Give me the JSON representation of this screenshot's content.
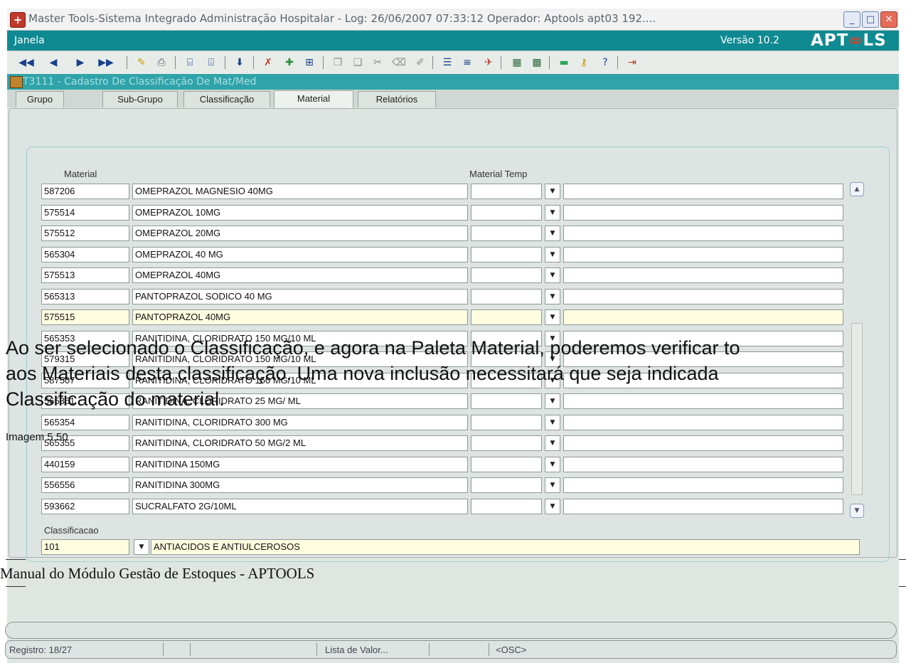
{
  "window": {
    "title": "Master Tools-Sistema Integrado Administração Hospitalar - Log: 26/06/2007 07:33:12 Operador: Aptools apt03 192....",
    "controls": {
      "minimize": "_",
      "maximize": "□",
      "close": "✕"
    }
  },
  "menubar": {
    "janela": "Janela",
    "version": "Versão 10.2",
    "logo_a": "APT",
    "logo_o": "∞",
    "logo_b": "LS"
  },
  "form": {
    "title": "T3111 - Cadastro De Classificação De Mat/Med"
  },
  "tabs": [
    {
      "label": "Grupo",
      "active": false
    },
    {
      "label": "Sub-Grupo",
      "active": false
    },
    {
      "label": "Classificação",
      "active": false
    },
    {
      "label": "Material",
      "active": true
    },
    {
      "label": "Relatórios",
      "active": false
    }
  ],
  "grid": {
    "header_material": "Material",
    "header_material_temp": "Material Temp",
    "rows": [
      {
        "code": "587206",
        "name": "OMEPRAZOL MAGNESIO 40MG",
        "temp": "",
        "desc": ""
      },
      {
        "code": "575514",
        "name": "OMEPRAZOL 10MG",
        "temp": "",
        "desc": ""
      },
      {
        "code": "575512",
        "name": "OMEPRAZOL 20MG",
        "temp": "",
        "desc": ""
      },
      {
        "code": "565304",
        "name": "OMEPRAZOL 40 MG",
        "temp": "",
        "desc": ""
      },
      {
        "code": "575513",
        "name": "OMEPRAZOL 40MG",
        "temp": "",
        "desc": ""
      },
      {
        "code": "565313",
        "name": "PANTOPRAZOL SODICO 40 MG",
        "temp": "",
        "desc": ""
      },
      {
        "code": "575515",
        "name": "PANTOPRAZOL 40MG",
        "temp": "",
        "desc": "",
        "selected": true
      },
      {
        "code": "565353",
        "name": "RANITIDINA, CLORIDRATO 150 MG/10 ML",
        "temp": "",
        "desc": ""
      },
      {
        "code": "579315",
        "name": "RANITIDINA, CLORIDRATO 150 MG/10 ML",
        "temp": "",
        "desc": ""
      },
      {
        "code": "587507",
        "name": "RANITIDINA, CLORIDRATO 150 MG/10 ML",
        "temp": "",
        "desc": ""
      },
      {
        "code": "565351",
        "name": "RANITIDINA, CLORIDRATO 25 MG/ ML",
        "temp": "",
        "desc": ""
      },
      {
        "code": "565354",
        "name": "RANITIDINA, CLORIDRATO 300 MG",
        "temp": "",
        "desc": ""
      },
      {
        "code": "565355",
        "name": "RANITIDINA, CLORIDRATO 50 MG/2 ML",
        "temp": "",
        "desc": ""
      },
      {
        "code": "440159",
        "name": "RANITIDINA 150MG",
        "temp": "",
        "desc": ""
      },
      {
        "code": "556556",
        "name": "RANITIDINA 300MG",
        "temp": "",
        "desc": ""
      },
      {
        "code": "593662",
        "name": "SUCRALFATO 2G/10ML",
        "temp": "",
        "desc": ""
      }
    ]
  },
  "classificacao": {
    "label": "Classificacao",
    "code": "101",
    "name": "ANTIACIDOS E ANTIULCEROSOS"
  },
  "status": {
    "registro": "Registro: 18/27",
    "lista": "Lista de Valor...",
    "osc": "<OSC>"
  },
  "overlay": {
    "line1": "Ao ser selecionado o Classificação, e agora na Paleta Material, poderemos verificar to",
    "line2": "aos Materiais desta classificação. Uma nova inclusão necessitará que seja indicada",
    "line3": "Classificação do material.",
    "caption": "Imagem 5.50"
  },
  "footer": {
    "text": "Manual do Módulo Gestão de Estoques - APTOOLS"
  }
}
